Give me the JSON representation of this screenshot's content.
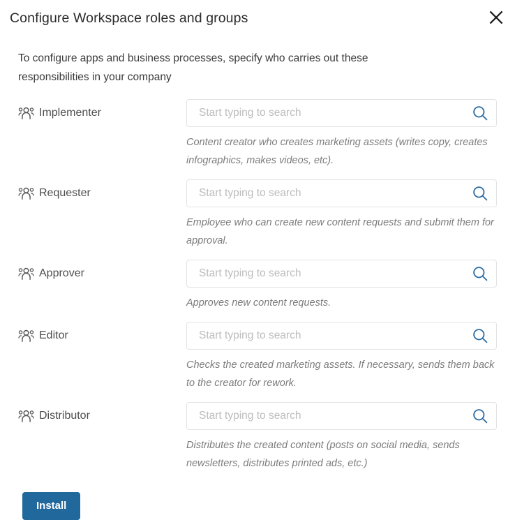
{
  "dialog": {
    "title": "Configure Workspace roles and groups",
    "close_icon": "close-icon",
    "intro": "To configure apps and business processes, specify who carries out these responsibilities in your company"
  },
  "search": {
    "placeholder": "Start typing to search",
    "value": "",
    "icon": "search-icon"
  },
  "icons": {
    "group": "group-people-icon"
  },
  "colors": {
    "accent_blue": "#21689c",
    "search_icon_blue": "#2b6ca3",
    "border": "#e2e3e4",
    "placeholder": "#bcbcbc",
    "description_text": "#7c7c7c",
    "label_text": "#4e4e4e",
    "title_text": "#2b2b2b"
  },
  "roles": [
    {
      "label": "Implementer",
      "description": "Content creator who creates marketing assets (writes copy, creates infographics, makes videos, etc)."
    },
    {
      "label": "Requester",
      "description": "Employee who can create new content requests and submit them for approval."
    },
    {
      "label": "Approver",
      "description": "Approves new content requests."
    },
    {
      "label": "Editor",
      "description": "Checks the created marketing assets. If necessary, sends them back to the creator for rework."
    },
    {
      "label": "Distributor",
      "description": "Distributes the created content (posts on social media, sends newsletters, distributes printed ads, etc.)"
    }
  ],
  "footer": {
    "install_label": "Install"
  }
}
